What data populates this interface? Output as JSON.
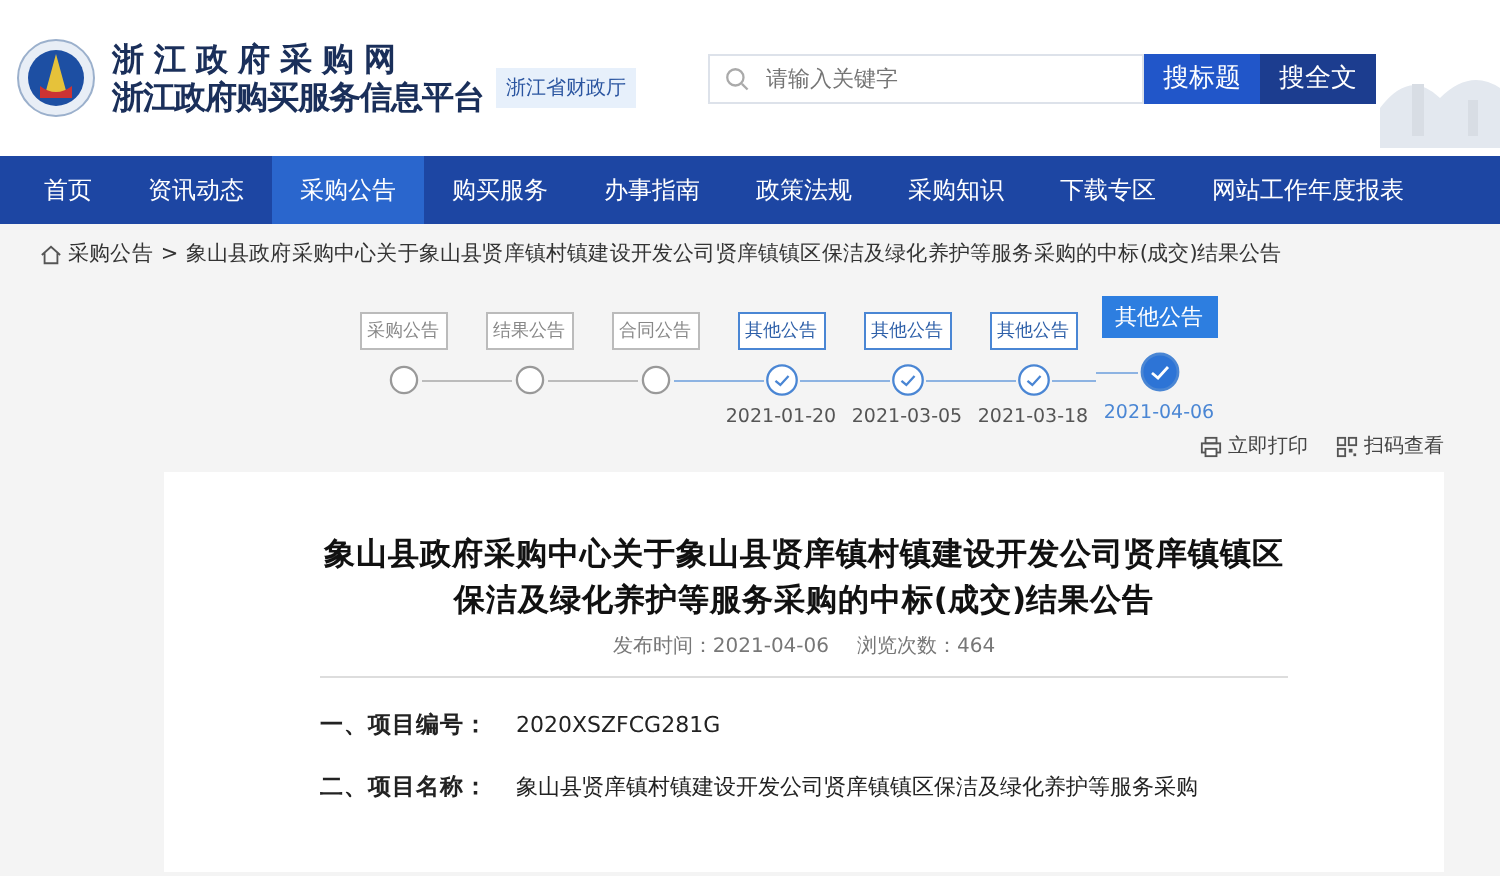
{
  "header": {
    "title_line1": "浙江政府采购网",
    "title_line2": "浙江政府购买服务信息平台",
    "badge": "浙江省财政厅",
    "search": {
      "placeholder": "请输入关键字"
    },
    "buttons": [
      "搜标题",
      "搜全文"
    ]
  },
  "nav": [
    {
      "label": "首页",
      "selected": false
    },
    {
      "label": "资讯动态",
      "selected": false
    },
    {
      "label": "采购公告",
      "selected": true
    },
    {
      "label": "购买服务",
      "selected": false
    },
    {
      "label": "办事指南",
      "selected": false
    },
    {
      "label": "政策法规",
      "selected": false
    },
    {
      "label": "采购知识",
      "selected": false
    },
    {
      "label": "下载专区",
      "selected": false
    },
    {
      "label": "网站工作年度报表",
      "selected": false
    }
  ],
  "breadcrumb": {
    "home": "采购公告",
    "separator": ">",
    "current": "象山县政府采购中心关于象山县贤庠镇村镇建设开发公司贤庠镇镇区保洁及绿化养护等服务采购的中标(成交)结果公告"
  },
  "timeline": [
    {
      "label": "采购公告",
      "done": false,
      "selected": false
    },
    {
      "label": "结果公告",
      "done": false,
      "selected": false
    },
    {
      "label": "合同公告",
      "done": false,
      "selected": false
    },
    {
      "label": "其他公告",
      "done": true,
      "date": "2021-01-20",
      "selected": false
    },
    {
      "label": "其他公告",
      "done": true,
      "date": "2021-03-05",
      "selected": false
    },
    {
      "label": "其他公告",
      "done": true,
      "date": "2021-03-18",
      "selected": false
    },
    {
      "label": "其他公告",
      "done": true,
      "date": "2021-04-06",
      "selected": true
    }
  ],
  "tools": [
    "立即打印",
    "扫码查看"
  ],
  "article": {
    "title": "象山县政府采购中心关于象山县贤庠镇村镇建设开发公司贤庠镇镇区保洁及绿化养护等服务采购的中标(成交)结果公告",
    "publish": "发布时间：2021-04-06",
    "views": "浏览次数：464",
    "fields": [
      {
        "label": "一、项目编号：",
        "value": "2020XSZFCG281G"
      },
      {
        "label": "二、项目名称：",
        "value": "象山县贤庠镇村镇建设开发公司贤庠镇镇区保洁及绿化养护等服务采购"
      }
    ]
  }
}
